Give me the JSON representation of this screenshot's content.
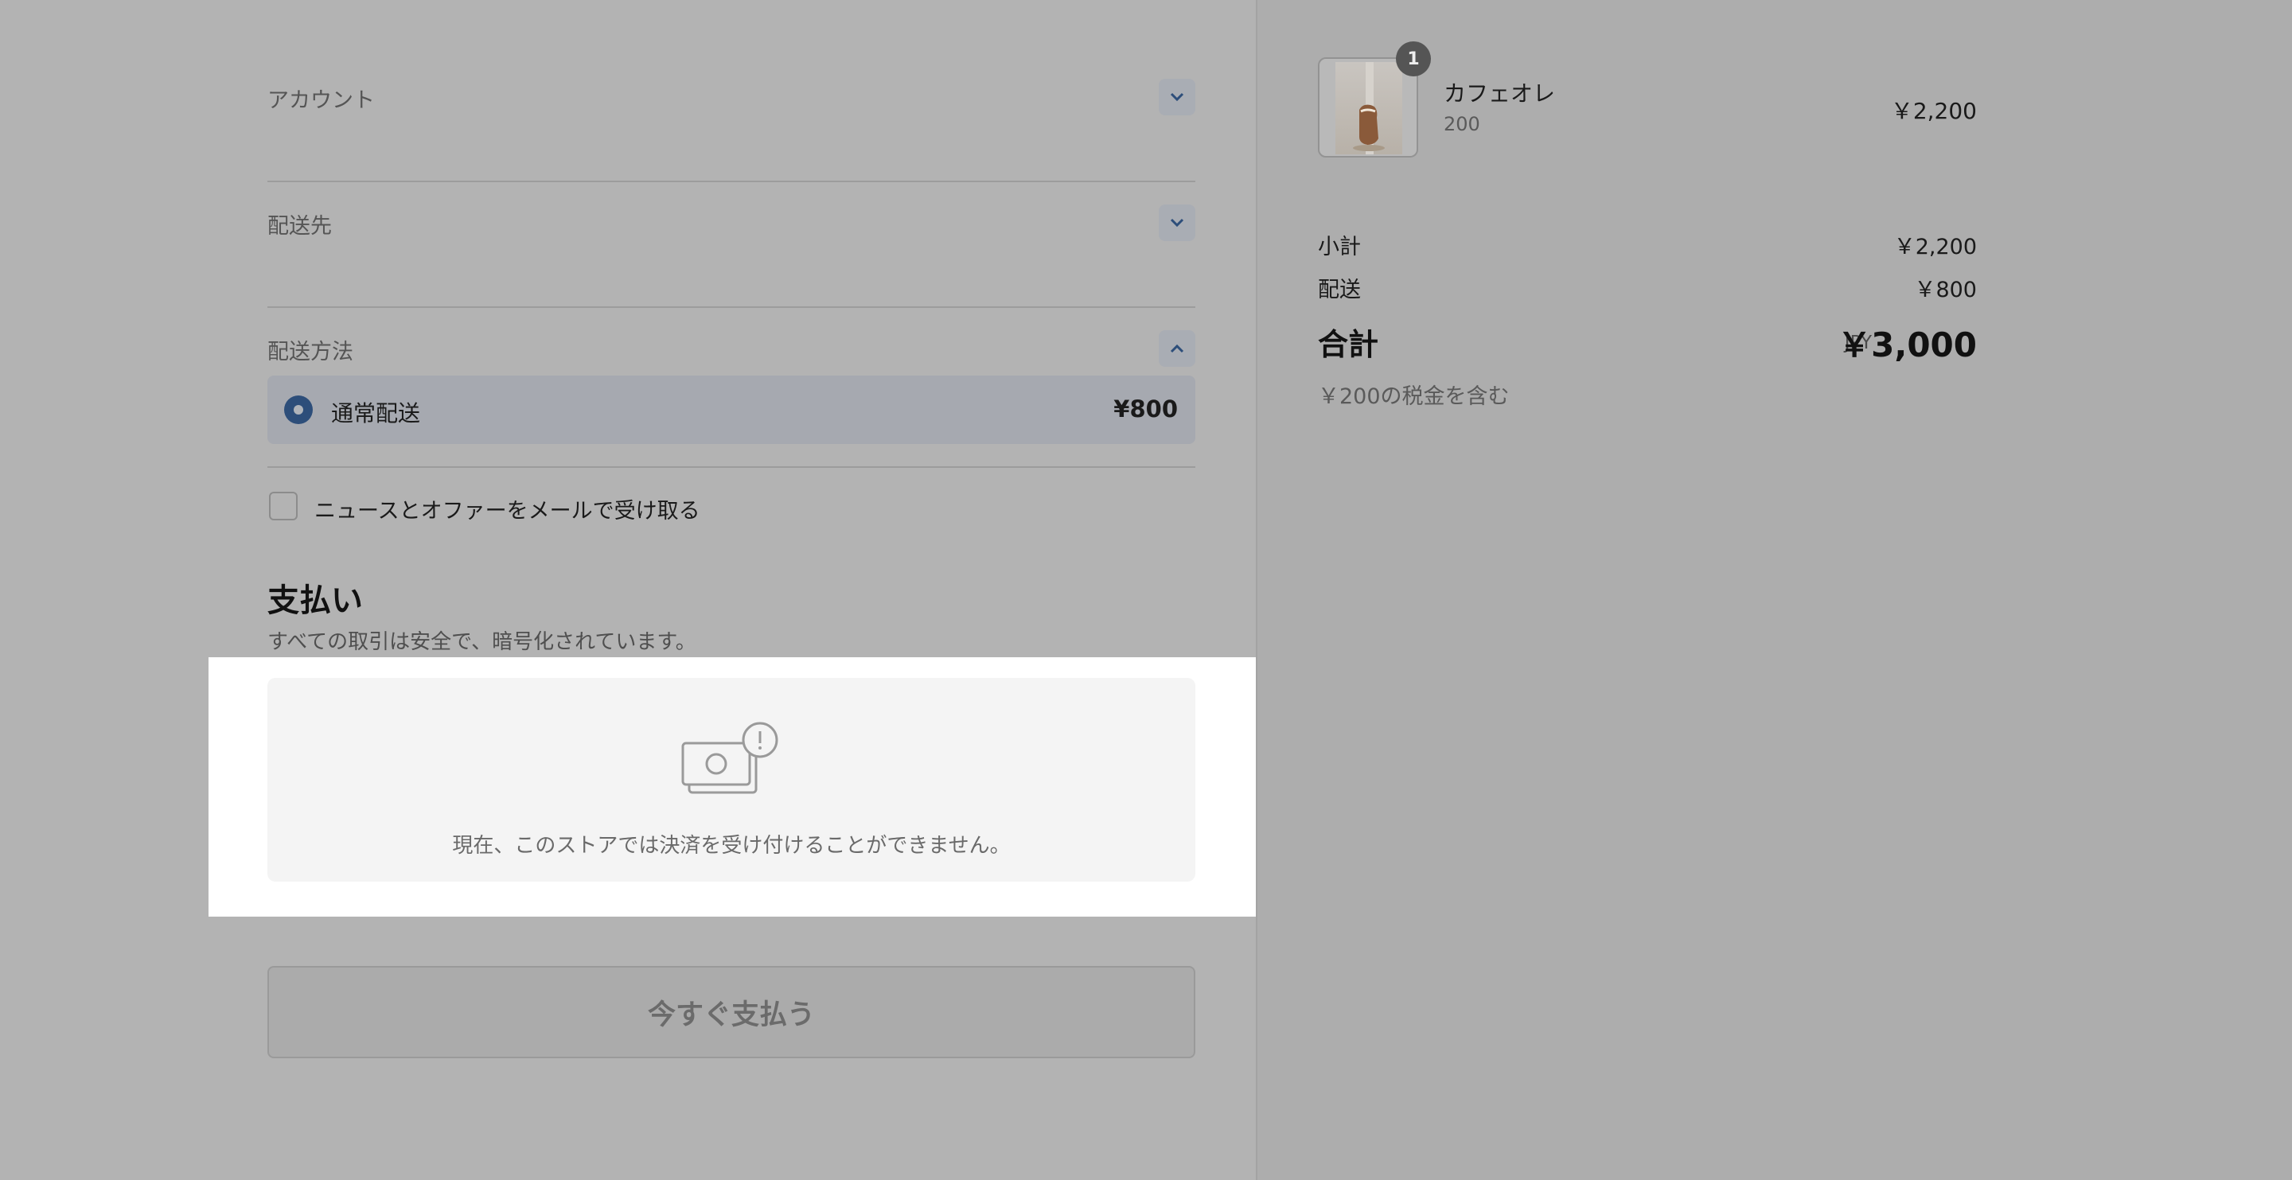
{
  "checkout": {
    "account_label": "アカウント",
    "shipping_to_label": "配送先",
    "shipping_method_label": "配送方法",
    "shipping_option": {
      "label": "通常配送",
      "price": "¥800",
      "selected": true
    },
    "newsletter_label": "ニュースとオファーをメールで受け取る",
    "newsletter_checked": false
  },
  "payment": {
    "title": "支払い",
    "subtitle": "すべての取引は安全で、暗号化されています。",
    "unavailable_icon": "cash-warning-icon",
    "unavailable_message": "現在、このストアでは決済を受け付けることができません。",
    "pay_button": "今すぐ支払う"
  },
  "order": {
    "item": {
      "name": "カフェオレ",
      "variant": "200",
      "quantity": "1",
      "price": "￥2,200"
    },
    "subtotal_label": "小計",
    "subtotal_value": "￥2,200",
    "shipping_label": "配送",
    "shipping_value": "￥800",
    "total_label": "合計",
    "currency": "JPY",
    "total_value": "￥3,000",
    "tax_note": "￥200の税金を含む"
  },
  "colors": {
    "accent": "#2d4e7a",
    "overlay": "#b3b3b3",
    "highlight": "#ffffff"
  }
}
